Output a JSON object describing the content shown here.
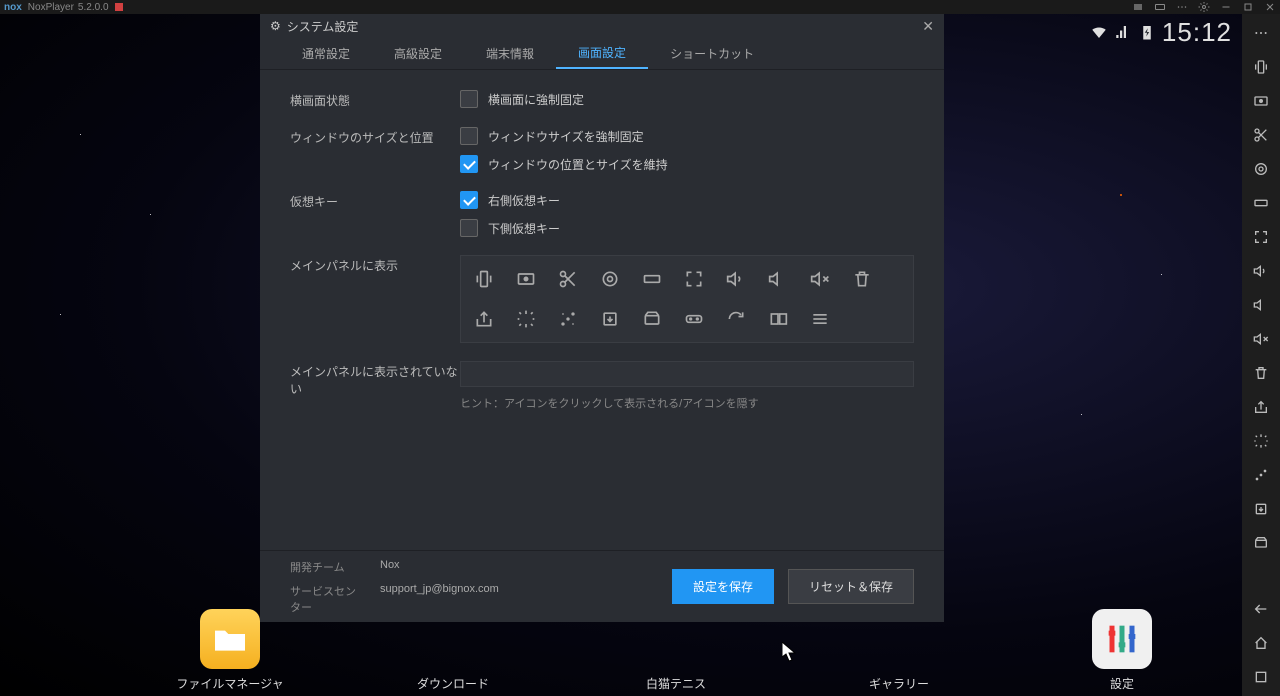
{
  "titlebar": {
    "app": "NoxPlayer",
    "version": "5.2.0.0"
  },
  "android_status": {
    "time": "15:12"
  },
  "dialog": {
    "title": "システム設定",
    "tabs": [
      "通常設定",
      "高級設定",
      "端末情報",
      "画面設定",
      "ショートカット"
    ],
    "active_tab_index": 3,
    "sections": {
      "orientation_label": "横画面状態",
      "orientation_check1": "横画面に強制固定",
      "winsize_label": "ウィンドウのサイズと位置",
      "winsize_check1": "ウィンドウサイズを強制固定",
      "winsize_check2": "ウィンドウの位置とサイズを維持",
      "virtualkey_label": "仮想キー",
      "virtualkey_check1": "右側仮想キー",
      "virtualkey_check2": "下側仮想キー",
      "mainpanel_shown_label": "メインパネルに表示",
      "mainpanel_hidden_label": "メインパネルに表示されていない",
      "hint": "ヒント：アイコンをクリックして表示される/アイコンを隠す"
    },
    "footer": {
      "dev_team_label": "開発チーム",
      "dev_team_value": "Nox",
      "support_label": "サービスセンター",
      "support_value": "support_jp@bignox.com",
      "save_label": "設定を保存",
      "reset_label": "リセット＆保存"
    }
  },
  "dock": {
    "items": [
      "ファイルマネージャ",
      "ダウンロード",
      "白猫テニス",
      "ギャラリー",
      "設定"
    ]
  }
}
